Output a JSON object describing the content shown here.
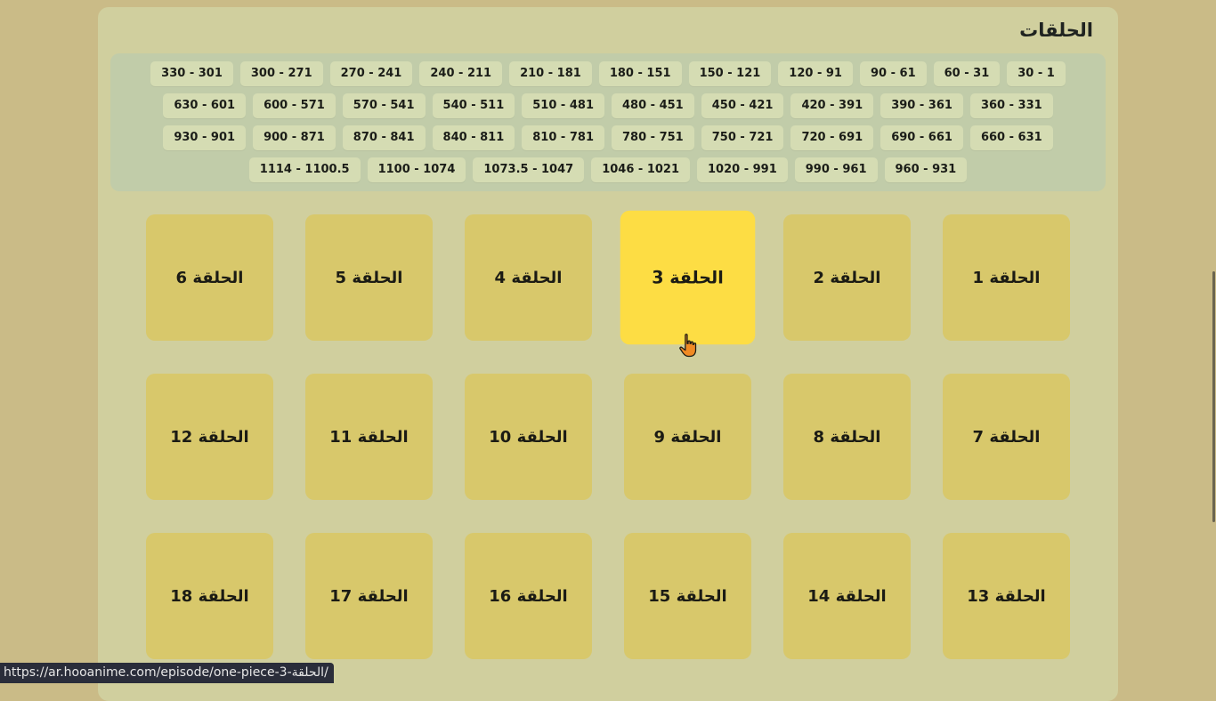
{
  "section": {
    "title": "الحلقات"
  },
  "ranges": [
    "30 - 1",
    "60 - 31",
    "90 - 61",
    "120 - 91",
    "150 - 121",
    "180 - 151",
    "210 - 181",
    "240 - 211",
    "270 - 241",
    "300 - 271",
    "330 - 301",
    "360 - 331",
    "390 - 361",
    "420 - 391",
    "450 - 421",
    "480 - 451",
    "510 - 481",
    "540 - 511",
    "570 - 541",
    "600 - 571",
    "630 - 601",
    "660 - 631",
    "690 - 661",
    "720 - 691",
    "750 - 721",
    "780 - 751",
    "810 - 781",
    "840 - 811",
    "870 - 841",
    "900 - 871",
    "930 - 901",
    "960 - 931",
    "990 - 961",
    "1020 - 991",
    "1046 - 1021",
    "1073.5 - 1047",
    "1100 - 1074",
    "1114 - 1100.5"
  ],
  "episodes": [
    "الحلقة 1",
    "الحلقة 2",
    "الحلقة 3",
    "الحلقة 4",
    "الحلقة 5",
    "الحلقة 6",
    "الحلقة 7",
    "الحلقة 8",
    "الحلقة 9",
    "الحلقة 10",
    "الحلقة 11",
    "الحلقة 12",
    "الحلقة 13",
    "الحلقة 14",
    "الحلقة 15",
    "الحلقة 16",
    "الحلقة 17",
    "الحلقة 18"
  ],
  "hovered_episode": "الحلقة 3",
  "status_bar": {
    "url": "https://ar.hooanime.com/episode/one-piece-3-الحلقة/"
  },
  "colors": {
    "page_bg": "#cabb87",
    "panel_bg": "#d0cf9e",
    "ranges_bg": "#c1cca9",
    "range_btn": "#d5dcb3",
    "episode_card": "#d8c86b",
    "episode_card_hover": "#fddd44"
  },
  "icons": {
    "cursor": "hand-pointer-icon"
  }
}
